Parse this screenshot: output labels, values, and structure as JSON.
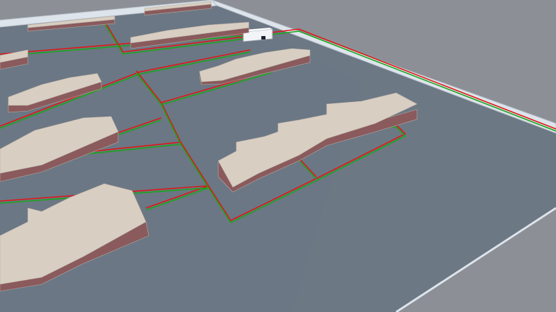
{
  "scene": {
    "view": "3d-perspective-layout",
    "background_color": "#8c9096",
    "ground_color": "#6b7784",
    "rail_color": "#dde4ec",
    "block_top_color": "#d8cec2",
    "block_side_color": "#8a5a5c",
    "cable_colors": {
      "primary": "#1aa51a",
      "secondary": "#e01515"
    },
    "structure_count": 9,
    "equipment_box": {
      "icon": "equipment-box-icon",
      "color": "#f2f4f7"
    }
  }
}
